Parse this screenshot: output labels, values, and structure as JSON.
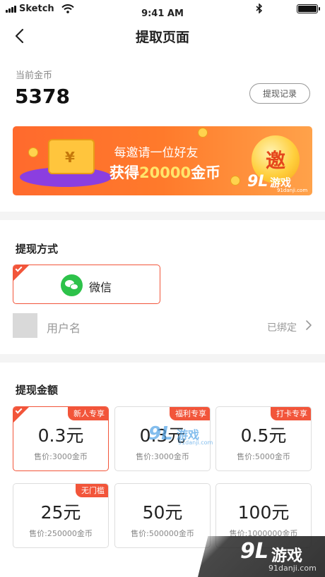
{
  "status_bar": {
    "carrier": "Sketch",
    "time": "9:41 AM"
  },
  "nav": {
    "title": "提取页面"
  },
  "balance": {
    "label": "当前金币",
    "value": "5378",
    "history_button": "提现记录"
  },
  "banner": {
    "line1": "每邀请一位好友",
    "line2_prefix": "获得",
    "line2_highlight": "20000",
    "line2_suffix": "金币",
    "badge": "邀",
    "wallet_symbol": "¥"
  },
  "withdraw_method": {
    "title": "提现方式",
    "options": [
      {
        "label": "微信",
        "selected": true
      }
    ],
    "account": {
      "placeholder": "用户名",
      "status": "已绑定"
    }
  },
  "withdraw_amount": {
    "title": "提现金额",
    "options": [
      {
        "tag": "新人专享",
        "value": "0.3元",
        "price": "售价:3000金币",
        "selected": true
      },
      {
        "tag": "福利专享",
        "value": "0.3元",
        "price": "售价:3000金币",
        "selected": false
      },
      {
        "tag": "打卡专享",
        "value": "0.5元",
        "price": "售价:5000金币",
        "selected": false
      },
      {
        "tag": "无门槛",
        "value": "25元",
        "price": "售价:250000金币",
        "selected": false
      },
      {
        "tag": "",
        "value": "50元",
        "price": "售价:500000金币",
        "selected": false
      },
      {
        "tag": "",
        "value": "100元",
        "price": "售价:1000000金币",
        "selected": false
      }
    ]
  },
  "watermark": {
    "number": "9L",
    "text": "游戏",
    "url": "91danji.com"
  },
  "colors": {
    "accent": "#f2553a",
    "wechat": "#2dc24a",
    "banner_start": "#ff6a2d",
    "banner_end": "#ffa24a"
  }
}
